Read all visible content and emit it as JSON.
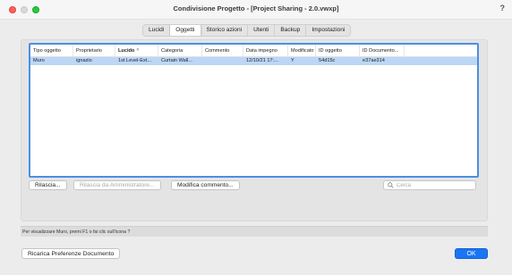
{
  "window": {
    "title": "Condivisione Progetto - [Project Sharing - 2.0.vwxp]",
    "help_label": "?"
  },
  "tabs": [
    {
      "label": "Lucidi",
      "active": false
    },
    {
      "label": "Oggetti",
      "active": true
    },
    {
      "label": "Storico azioni",
      "active": false
    },
    {
      "label": "Utenti",
      "active": false
    },
    {
      "label": "Backup",
      "active": false
    },
    {
      "label": "Impostazioni",
      "active": false
    }
  ],
  "table": {
    "columns": [
      "Tipo oggetto",
      "Proprietario",
      "Lucido",
      "Categoria",
      "Commento",
      "Data impegno",
      "Modificato",
      "ID oggetto",
      "ID Documento..."
    ],
    "sorted_column": "Lucido",
    "sort_indicator": "^",
    "rows": [
      [
        "Muro",
        "ignazio",
        "1st Level-Ext...",
        "Curtain Wall...",
        "",
        "12/10/21 17:...",
        "Y",
        "54d15c",
        "e37ae314"
      ]
    ]
  },
  "buttons": {
    "release": "Rilascia...",
    "admin_release": "Rilascia da Amministratore...",
    "edit_comment": "Modifica commento..."
  },
  "search": {
    "placeholder": "Cerca"
  },
  "status": {
    "text": "Per visualizzare Muro, premi F1 o fai clic sull'icona ?"
  },
  "footer": {
    "reload_label": "Ricarica Preferenze Documento",
    "ok_label": "OK"
  },
  "colors": {
    "accent": "#1a75f6",
    "selection": "#bcd7f6",
    "close": "#fe5f57",
    "zoom": "#28c840"
  }
}
